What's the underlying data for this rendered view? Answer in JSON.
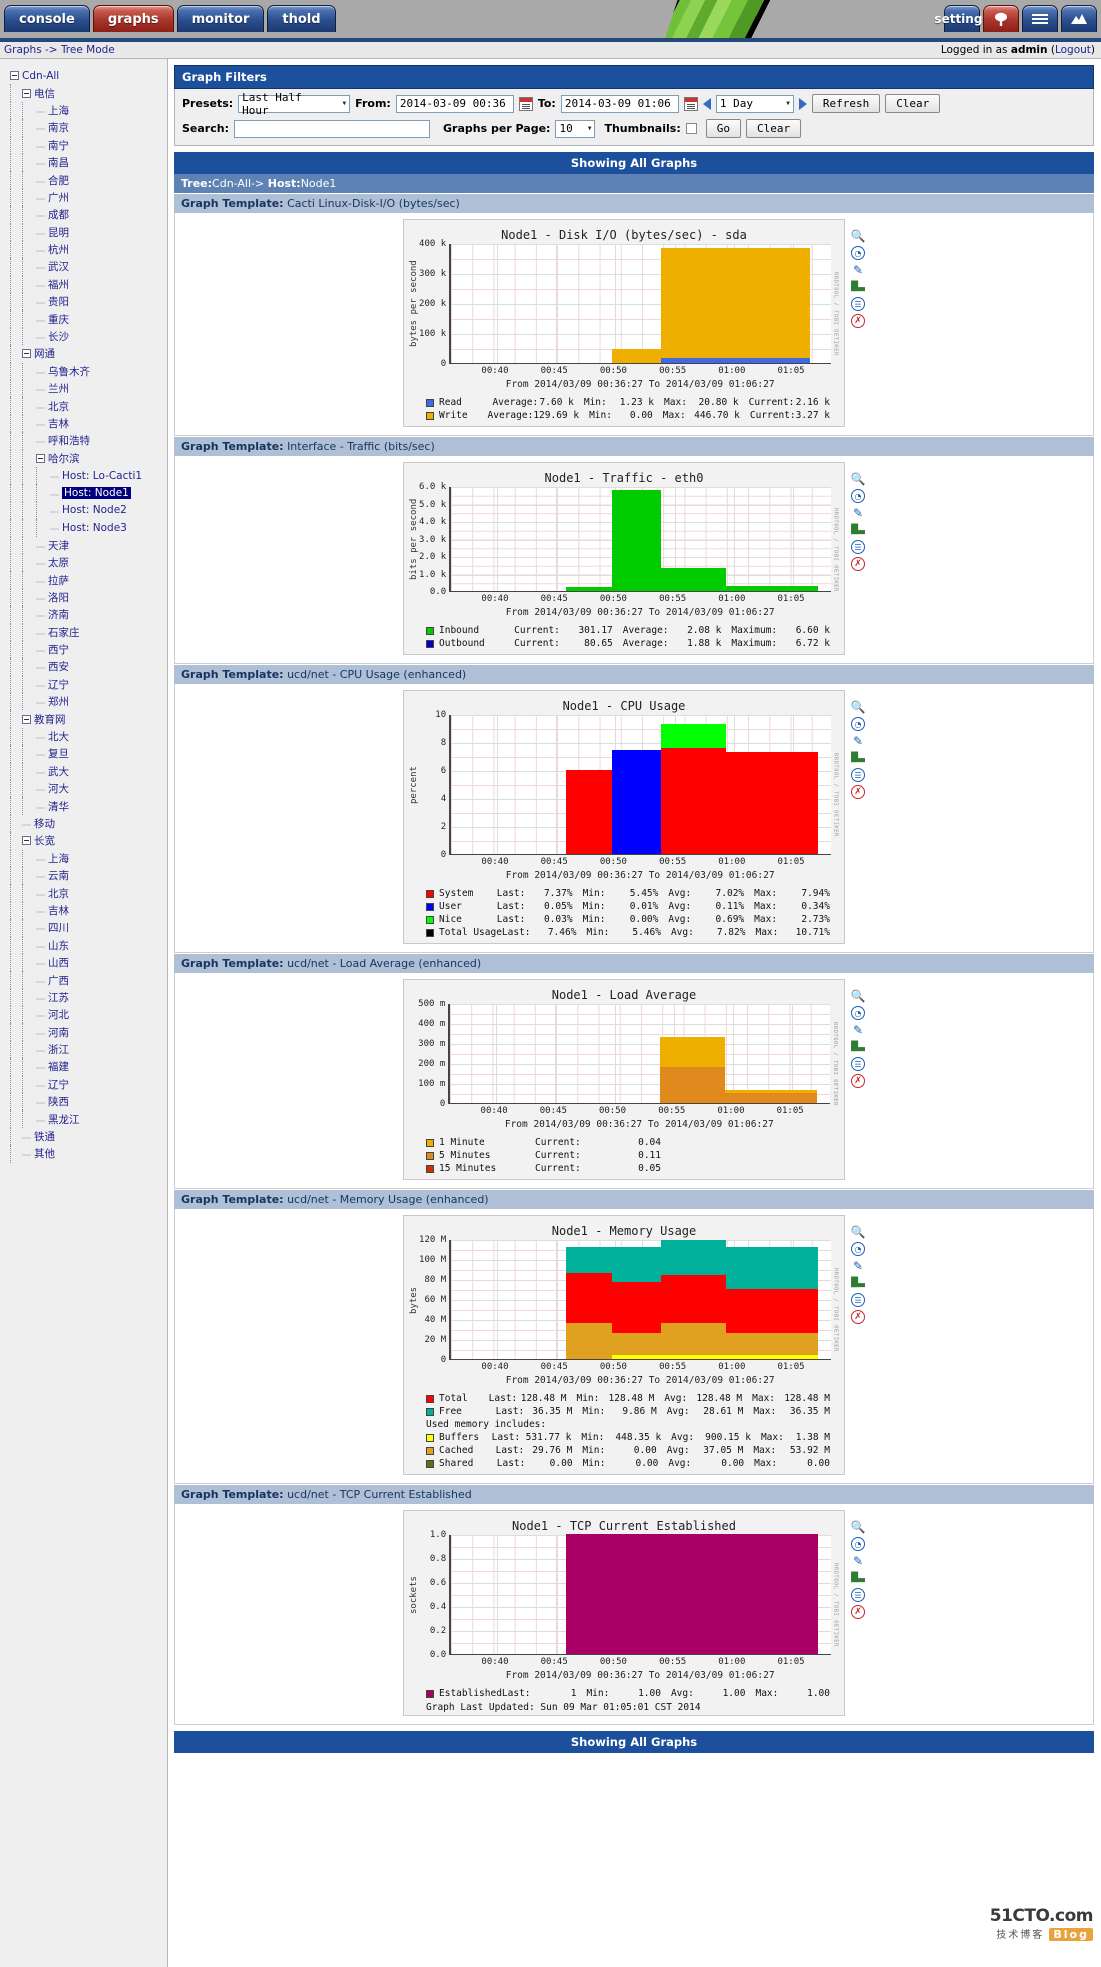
{
  "nav": {
    "tabs": [
      {
        "label": "console",
        "active": false
      },
      {
        "label": "graphs",
        "active": true
      },
      {
        "label": "monitor",
        "active": false
      },
      {
        "label": "thold",
        "active": false
      }
    ],
    "right_tabs": [
      {
        "label": "settings",
        "icon": "settings-text"
      },
      {
        "label": "",
        "icon": "tree-icon"
      },
      {
        "label": "",
        "icon": "list-icon"
      },
      {
        "label": "",
        "icon": "mountain-icon"
      }
    ]
  },
  "breadcrumb": {
    "path": "Graphs -> Tree Mode",
    "login_prefix": "Logged in as ",
    "user": "admin",
    "logout_open": " (",
    "logout": "Logout",
    "logout_close": ")"
  },
  "filters": {
    "title": "Graph Filters",
    "presets_label": "Presets:",
    "presets_value": "Last Half Hour",
    "from_label": "From:",
    "from_value": "2014-03-09 00:36",
    "to_label": "To:",
    "to_value": "2014-03-09 01:06",
    "span_value": "1 Day",
    "refresh": "Refresh",
    "clear": "Clear",
    "search_label": "Search:",
    "search_value": "",
    "gpp_label": "Graphs per Page:",
    "gpp_value": "10",
    "thumbs_label": "Thumbnails:",
    "go": "Go",
    "clear2": "Clear"
  },
  "showing_top": "Showing All Graphs",
  "showing_bottom": "Showing All Graphs",
  "tree_header": {
    "prefix": "Tree:",
    "tree": "Cdn-All",
    "arrow": "-> ",
    "host_label": "Host:",
    "host": "Node1"
  },
  "sidebar": {
    "nodes": [
      {
        "label": "Cdn-All",
        "depth": 0,
        "toggle": true,
        "bold": false
      },
      {
        "label": "电信",
        "depth": 1,
        "toggle": true,
        "bold": false
      },
      {
        "label": "上海",
        "depth": 2,
        "toggle": false
      },
      {
        "label": "南京",
        "depth": 2,
        "toggle": false
      },
      {
        "label": "南宁",
        "depth": 2,
        "toggle": false
      },
      {
        "label": "南昌",
        "depth": 2,
        "toggle": false
      },
      {
        "label": "合肥",
        "depth": 2,
        "toggle": false
      },
      {
        "label": "广州",
        "depth": 2,
        "toggle": false
      },
      {
        "label": "成都",
        "depth": 2,
        "toggle": false
      },
      {
        "label": "昆明",
        "depth": 2,
        "toggle": false
      },
      {
        "label": "杭州",
        "depth": 2,
        "toggle": false
      },
      {
        "label": "武汉",
        "depth": 2,
        "toggle": false
      },
      {
        "label": "福州",
        "depth": 2,
        "toggle": false
      },
      {
        "label": "贵阳",
        "depth": 2,
        "toggle": false
      },
      {
        "label": "重庆",
        "depth": 2,
        "toggle": false
      },
      {
        "label": "长沙",
        "depth": 2,
        "toggle": false
      },
      {
        "label": "网通",
        "depth": 1,
        "toggle": true
      },
      {
        "label": "乌鲁木齐",
        "depth": 2,
        "toggle": false
      },
      {
        "label": "兰州",
        "depth": 2,
        "toggle": false
      },
      {
        "label": "北京",
        "depth": 2,
        "toggle": false
      },
      {
        "label": "吉林",
        "depth": 2,
        "toggle": false
      },
      {
        "label": "呼和浩特",
        "depth": 2,
        "toggle": false
      },
      {
        "label": "哈尔滨",
        "depth": 2,
        "toggle": true
      },
      {
        "label": "Host: Lo-Cacti1",
        "depth": 3,
        "toggle": false
      },
      {
        "label": "Host: Node1",
        "depth": 3,
        "toggle": false,
        "selected": true
      },
      {
        "label": "Host: Node2",
        "depth": 3,
        "toggle": false
      },
      {
        "label": "Host: Node3",
        "depth": 3,
        "toggle": false
      },
      {
        "label": "天津",
        "depth": 2,
        "toggle": false
      },
      {
        "label": "太原",
        "depth": 2,
        "toggle": false
      },
      {
        "label": "拉萨",
        "depth": 2,
        "toggle": false
      },
      {
        "label": "洛阳",
        "depth": 2,
        "toggle": false
      },
      {
        "label": "济南",
        "depth": 2,
        "toggle": false
      },
      {
        "label": "石家庄",
        "depth": 2,
        "toggle": false
      },
      {
        "label": "西宁",
        "depth": 2,
        "toggle": false
      },
      {
        "label": "西安",
        "depth": 2,
        "toggle": false
      },
      {
        "label": "辽宁",
        "depth": 2,
        "toggle": false
      },
      {
        "label": "郑州",
        "depth": 2,
        "toggle": false
      },
      {
        "label": "教育网",
        "depth": 1,
        "toggle": true
      },
      {
        "label": "北大",
        "depth": 2,
        "toggle": false
      },
      {
        "label": "复旦",
        "depth": 2,
        "toggle": false
      },
      {
        "label": "武大",
        "depth": 2,
        "toggle": false
      },
      {
        "label": "河大",
        "depth": 2,
        "toggle": false
      },
      {
        "label": "清华",
        "depth": 2,
        "toggle": false
      },
      {
        "label": "移动",
        "depth": 1,
        "toggle": false
      },
      {
        "label": "长宽",
        "depth": 1,
        "toggle": true
      },
      {
        "label": "上海",
        "depth": 2,
        "toggle": false
      },
      {
        "label": "云南",
        "depth": 2,
        "toggle": false
      },
      {
        "label": "北京",
        "depth": 2,
        "toggle": false
      },
      {
        "label": "吉林",
        "depth": 2,
        "toggle": false
      },
      {
        "label": "四川",
        "depth": 2,
        "toggle": false
      },
      {
        "label": "山东",
        "depth": 2,
        "toggle": false
      },
      {
        "label": "山西",
        "depth": 2,
        "toggle": false
      },
      {
        "label": "广西",
        "depth": 2,
        "toggle": false
      },
      {
        "label": "江苏",
        "depth": 2,
        "toggle": false
      },
      {
        "label": "河北",
        "depth": 2,
        "toggle": false
      },
      {
        "label": "河南",
        "depth": 2,
        "toggle": false
      },
      {
        "label": "浙江",
        "depth": 2,
        "toggle": false
      },
      {
        "label": "福建",
        "depth": 2,
        "toggle": false
      },
      {
        "label": "辽宁",
        "depth": 2,
        "toggle": false
      },
      {
        "label": "陕西",
        "depth": 2,
        "toggle": false
      },
      {
        "label": "黑龙江",
        "depth": 2,
        "toggle": false
      },
      {
        "label": "铁通",
        "depth": 1,
        "toggle": false
      },
      {
        "label": "其他",
        "depth": 1,
        "toggle": false
      }
    ]
  },
  "rrd_side_text": "RRDTOOL / TOBI OETIKER",
  "time_range": "From 2014/03/09 00:36:27 To 2014/03/09 01:06:27",
  "last_updated": "Graph Last Updated: Sun 09 Mar 01:05:01 CST 2014",
  "watermark": {
    "line1": "51CTO.com",
    "line2": "技术博客",
    "badge": "Blog"
  },
  "graphs": [
    {
      "template": "Cacti Linux-Disk-I/O (bytes/sec)",
      "title": "Node1 - Disk I/O (bytes/sec) - sda",
      "ylabel": "bytes per second",
      "yticks": [
        "400 k",
        "300 k",
        "200 k",
        "100 k",
        "0"
      ],
      "xticks": [
        "00:40",
        "00:45",
        "00:50",
        "00:55",
        "01:00",
        "01:05"
      ],
      "legend": [
        {
          "color": "#4169E1",
          "name": "Read",
          "cells": [
            "Average:",
            "7.60 k",
            "Min:",
            "1.23 k",
            "Max:",
            "20.80 k",
            "Current:",
            "2.16 k"
          ]
        },
        {
          "color": "#EFAF00",
          "name": "Write",
          "cells": [
            "Average:",
            "129.69 k",
            "Min:",
            "0.00",
            "Max:",
            "446.70 k",
            "Current:",
            "3.27 k"
          ]
        }
      ]
    },
    {
      "template": "Interface - Traffic (bits/sec)",
      "title": "Node1 - Traffic - eth0",
      "ylabel": "bits per second",
      "yticks": [
        "6.0 k",
        "5.0 k",
        "4.0 k",
        "3.0 k",
        "2.0 k",
        "1.0 k",
        "0.0"
      ],
      "xticks": [
        "00:40",
        "00:45",
        "00:50",
        "00:55",
        "01:00",
        "01:05"
      ],
      "legend": [
        {
          "color": "#00CC00",
          "name": "Inbound",
          "cells": [
            "Current:",
            "301.17",
            "Average:",
            "2.08 k",
            "Maximum:",
            "6.60 k"
          ]
        },
        {
          "color": "#0000CC",
          "name": "Outbound",
          "cells": [
            "Current:",
            "80.65",
            "Average:",
            "1.88 k",
            "Maximum:",
            "6.72 k"
          ]
        }
      ]
    },
    {
      "template": "ucd/net - CPU Usage (enhanced)",
      "title": "Node1 - CPU Usage",
      "ylabel": "percent",
      "yticks": [
        "10",
        "8",
        "6",
        "4",
        "2",
        "0"
      ],
      "xticks": [
        "00:40",
        "00:45",
        "00:50",
        "00:55",
        "01:00",
        "01:05"
      ],
      "legend": [
        {
          "color": "#FF0000",
          "name": "System",
          "cells": [
            "Last:",
            "7.37%",
            "Min:",
            "5.45%",
            "Avg:",
            "7.02%",
            "Max:",
            "7.94%"
          ]
        },
        {
          "color": "#0000FF",
          "name": "User",
          "cells": [
            "Last:",
            "0.05%",
            "Min:",
            "0.01%",
            "Avg:",
            "0.11%",
            "Max:",
            "0.34%"
          ]
        },
        {
          "color": "#00FF00",
          "name": "Nice",
          "cells": [
            "Last:",
            "0.03%",
            "Min:",
            "0.00%",
            "Avg:",
            "0.69%",
            "Max:",
            "2.73%"
          ]
        },
        {
          "color": "#000000",
          "name": "Total Usage",
          "cells": [
            "Last:",
            "7.46%",
            "Min:",
            "5.46%",
            "Avg:",
            "7.82%",
            "Max:",
            "10.71%"
          ]
        }
      ]
    },
    {
      "template": "ucd/net - Load Average (enhanced)",
      "title": "Node1 - Load Average",
      "ylabel": "",
      "yticks": [
        "500 m",
        "400 m",
        "300 m",
        "200 m",
        "100 m",
        "0"
      ],
      "xticks": [
        "00:40",
        "00:45",
        "00:50",
        "00:55",
        "01:00",
        "01:05"
      ],
      "legend": [
        {
          "color": "#EFAF00",
          "name": "1 Minute",
          "cells": [
            "Current:",
            "0.04"
          ]
        },
        {
          "color": "#E08A1E",
          "name": "5 Minutes",
          "cells": [
            "Current:",
            "0.11"
          ]
        },
        {
          "color": "#CC3300",
          "name": "15 Minutes",
          "cells": [
            "Current:",
            "0.05"
          ]
        }
      ]
    },
    {
      "template": "ucd/net - Memory Usage (enhanced)",
      "title": "Node1 - Memory Usage",
      "ylabel": "bytes",
      "yticks": [
        "120 M",
        "100 M",
        "80 M",
        "60 M",
        "40 M",
        "20 M",
        "0"
      ],
      "xticks": [
        "00:40",
        "00:45",
        "00:50",
        "00:55",
        "01:00",
        "01:05"
      ],
      "note": "Used memory includes:",
      "legend": [
        {
          "color": "#FF0000",
          "name": "Total",
          "cells": [
            "Last:",
            "128.48 M",
            "Min:",
            "128.48 M",
            "Avg:",
            "128.48 M",
            "Max:",
            "128.48 M"
          ]
        },
        {
          "color": "#00B09B",
          "name": "Free",
          "cells": [
            "Last:",
            "36.35 M",
            "Min:",
            "9.86 M",
            "Avg:",
            "28.61 M",
            "Max:",
            "36.35 M"
          ]
        },
        {
          "color": "#FFFF00",
          "name": "Buffers",
          "cells": [
            "Last:",
            "531.77 k",
            "Min:",
            "448.35 k",
            "Avg:",
            "900.15 k",
            "Max:",
            "1.38 M"
          ]
        },
        {
          "color": "#E0A020",
          "name": "Cached",
          "cells": [
            "Last:",
            "29.76 M",
            "Min:",
            "0.00",
            "Avg:",
            "37.05 M",
            "Max:",
            "53.92 M"
          ]
        },
        {
          "color": "#6B6B1E",
          "name": "Shared",
          "cells": [
            "Last:",
            "0.00",
            "Min:",
            "0.00",
            "Avg:",
            "0.00",
            "Max:",
            "0.00"
          ]
        }
      ]
    },
    {
      "template": "ucd/net - TCP Current Established",
      "title": "Node1 - TCP Current Established",
      "ylabel": "sockets",
      "yticks": [
        "1.0",
        "0.8",
        "0.6",
        "0.4",
        "0.2",
        "0.0"
      ],
      "xticks": [
        "00:40",
        "00:45",
        "00:50",
        "00:55",
        "01:00",
        "01:05"
      ],
      "legend": [
        {
          "color": "#AA0066",
          "name": "Established",
          "cells": [
            "Last:",
            "1",
            "Min:",
            "1.00",
            "Avg:",
            "1.00",
            "Max:",
            "1.00"
          ]
        }
      ]
    }
  ],
  "graph_icons": [
    "magnifier-icon",
    "clock-icon",
    "pencil-icon",
    "bar-chart-icon",
    "page-icon",
    "alert-icon"
  ]
}
